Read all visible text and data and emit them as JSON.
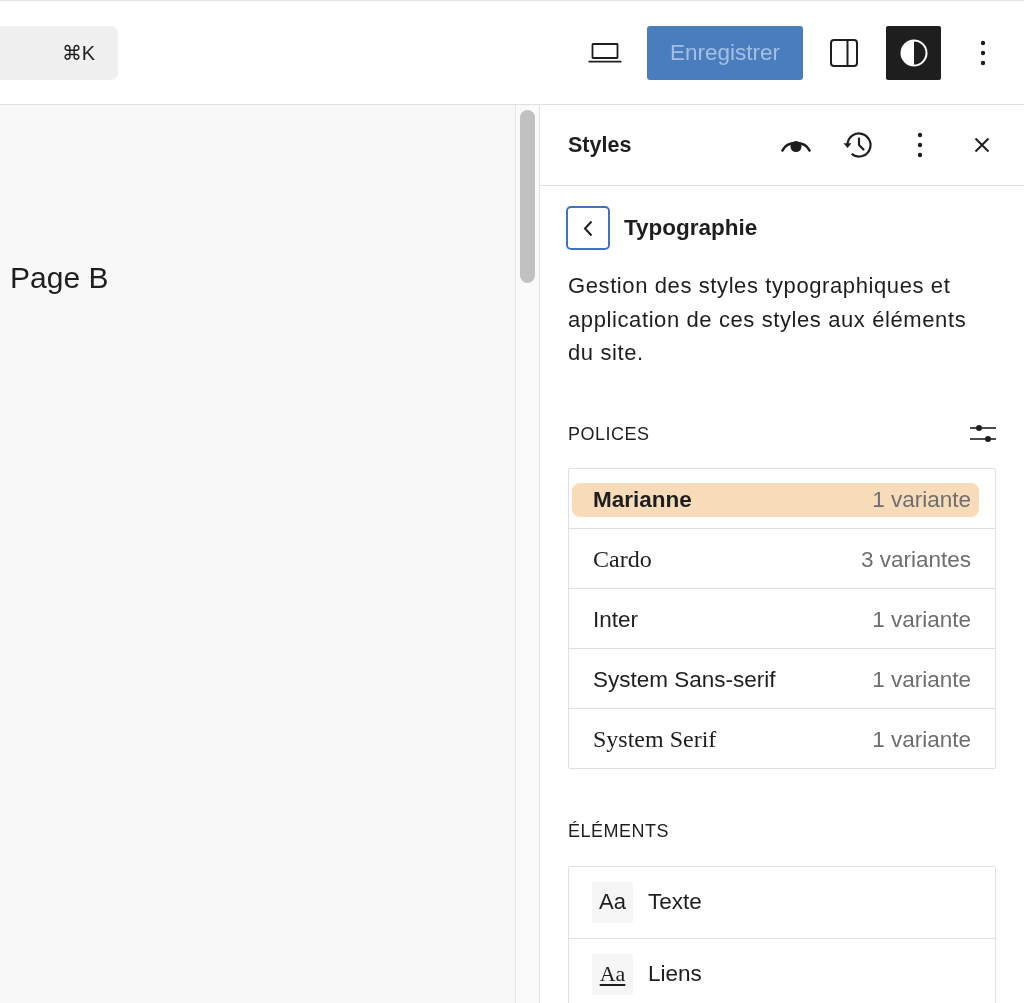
{
  "top_bar": {
    "command_palette": {
      "shortcut": "⌘K"
    },
    "save_button": {
      "label": "Enregistrer",
      "disabled": true
    },
    "sidebar_toggle": {
      "pressed": false
    },
    "styles_toggle": {
      "pressed": true
    }
  },
  "canvas": {
    "page_title": "Page B"
  },
  "styles_panel": {
    "title": "Styles",
    "section": {
      "title": "Typographie",
      "description": "Gestion des styles typographiques et application de ces styles aux éléments du site."
    },
    "fonts": {
      "heading": "POLICES",
      "items": [
        {
          "name": "Marianne",
          "variants": "1 variante",
          "kind": "sans-bold",
          "selected": true
        },
        {
          "name": "Cardo",
          "variants": "3 variantes",
          "kind": "serif",
          "selected": false
        },
        {
          "name": "Inter",
          "variants": "1 variante",
          "kind": "sans",
          "selected": false
        },
        {
          "name": "System Sans-serif",
          "variants": "1 variante",
          "kind": "sans",
          "selected": false
        },
        {
          "name": "System Serif",
          "variants": "1 variante",
          "kind": "serif",
          "selected": false
        }
      ]
    },
    "elements": {
      "heading": "ÉLÉMENTS",
      "items": [
        {
          "sample": "Aa",
          "label": "Texte",
          "kind": "text"
        },
        {
          "sample": "Aa",
          "label": "Liens",
          "kind": "link"
        }
      ]
    }
  }
}
